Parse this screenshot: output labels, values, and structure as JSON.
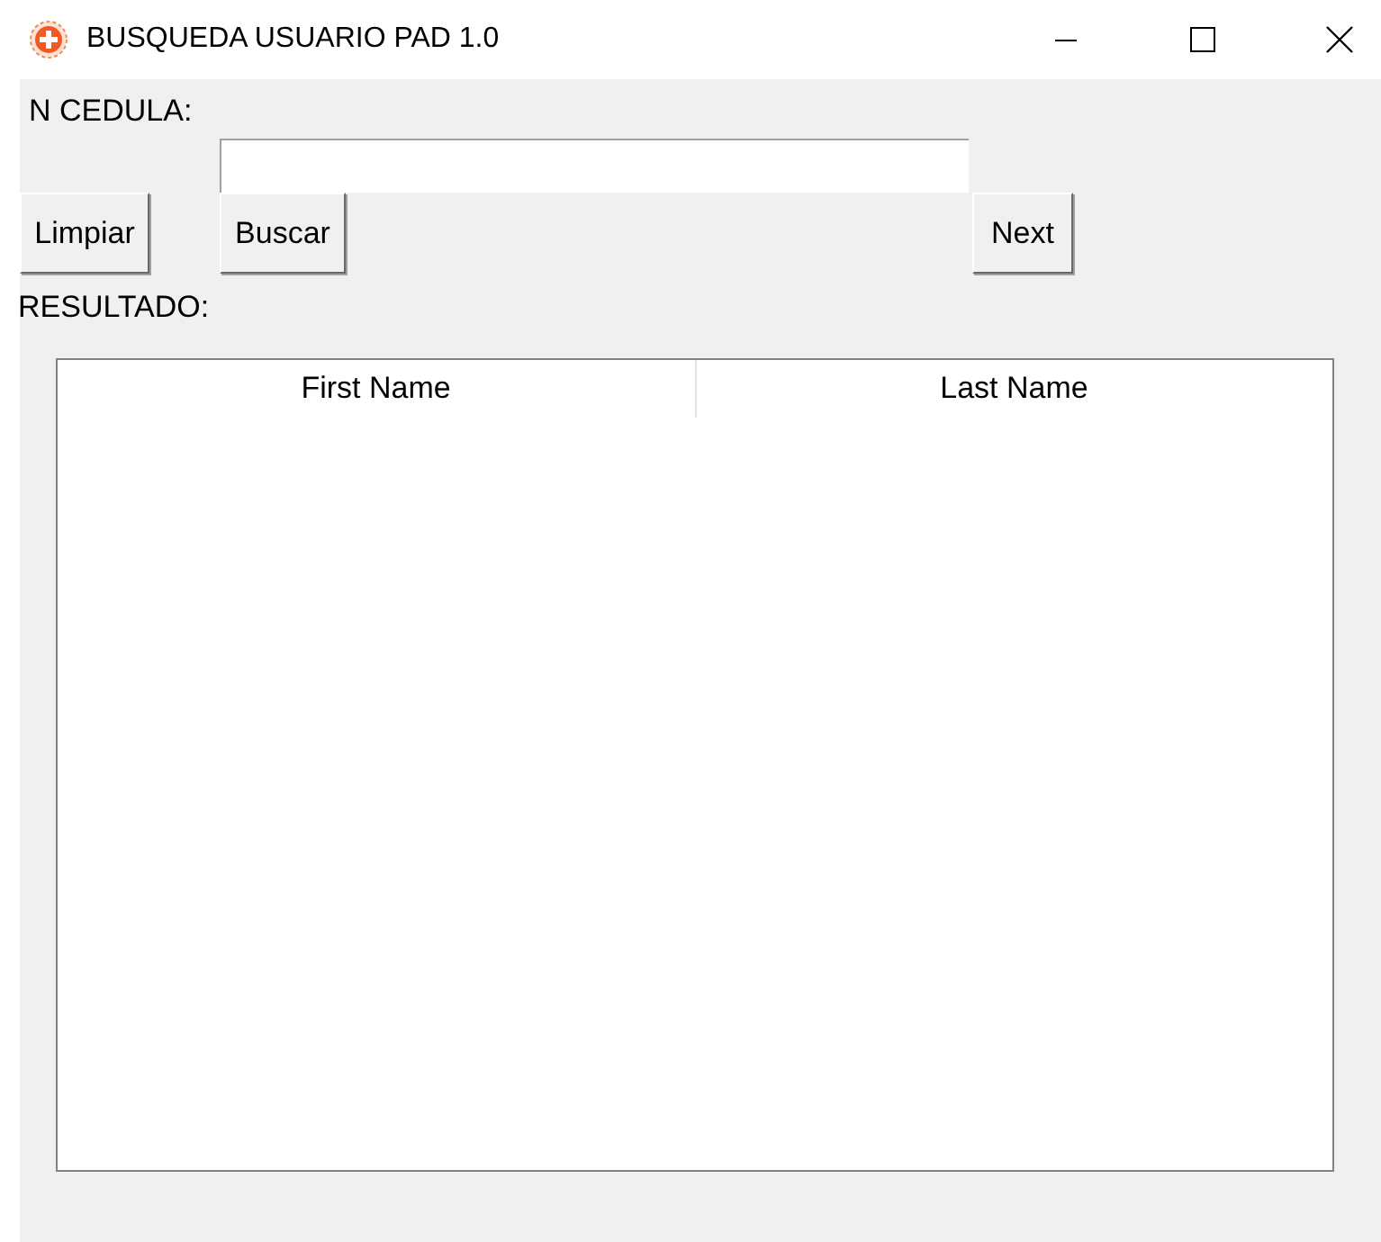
{
  "window": {
    "title": "BUSQUEDA USUARIO PAD 1.0"
  },
  "cedula": {
    "label": "N CEDULA:"
  },
  "buttons": [
    {
      "label": "Limpiar"
    },
    {
      "label": "Buscar"
    },
    {
      "label": "Next"
    }
  ],
  "result_label": "RESULTADO:",
  "table": {
    "columns": [
      "First Name",
      "Last Name"
    ]
  }
}
